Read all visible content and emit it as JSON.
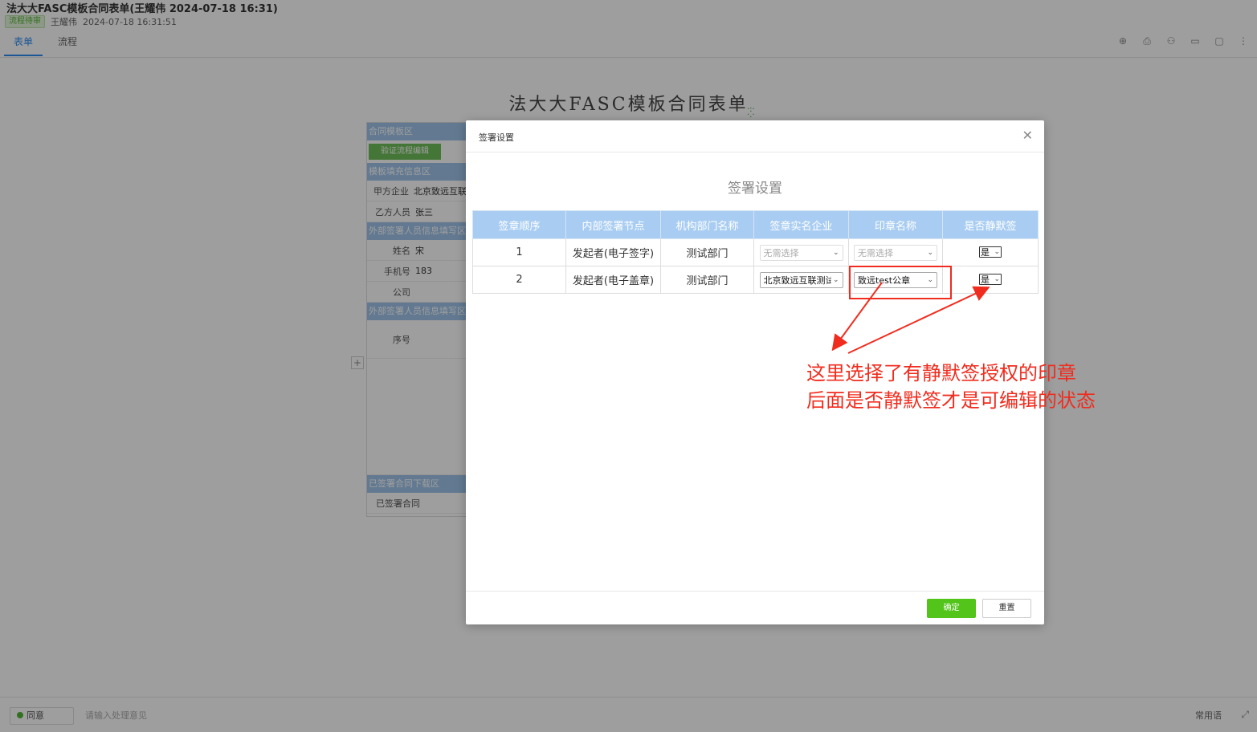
{
  "header": {
    "title": "法大大FASC模板合同表单(王耀伟 2024-07-18 16:31)",
    "status": "流程待审",
    "author": "王耀伟",
    "timestamp": "2024-07-18 16:31:51"
  },
  "tabs": [
    "表单",
    "流程"
  ],
  "form": {
    "title": "法大大FASC模板合同表单",
    "sections": {
      "contract_template": "合同模板区",
      "template_fill": "模板填充信息区",
      "external_signer": "外部签署人员信息填写区",
      "external_signer_2": "外部签署人员信息填写区",
      "signed_download": "已签署合同下载区"
    },
    "buttons": {
      "verify": "验证流程编辑"
    },
    "fields": [
      {
        "label": "甲方企业",
        "value": "北京致远互联"
      },
      {
        "label": "乙方人员",
        "value": "张三"
      },
      {
        "label": "姓名",
        "value": "宋"
      },
      {
        "label": "手机号",
        "value": "183"
      },
      {
        "label": "公司",
        "value": ""
      }
    ],
    "seq_label": "序号",
    "signed_contract_label": "已签署合同"
  },
  "bottom_bar": {
    "agree": "同意",
    "opinion_placeholder": "请输入处理意见",
    "common_phrases": "常用语"
  },
  "modal": {
    "title": "签署设置",
    "heading": "签署设置",
    "columns": [
      "签章顺序",
      "内部签署节点",
      "机构部门名称",
      "签章实名企业",
      "印章名称",
      "是否静默签"
    ],
    "rows": [
      {
        "order": "1",
        "node": "发起者(电子签字)",
        "dept": "测试部门",
        "company": "无需选择",
        "seal": "无需选择",
        "silent": "是"
      },
      {
        "order": "2",
        "node": "发起者(电子盖章)",
        "dept": "测试部门",
        "company": "北京致远互联测试",
        "seal": "致远test公章",
        "silent": "是"
      }
    ],
    "annotation": {
      "line1": "这里选择了有静默签授权的印章",
      "line2": "后面是否静默签才是可编辑的状态"
    },
    "ok_label": "确定",
    "cancel_label": "重置"
  },
  "colors": {
    "accent_green": "#52c41a",
    "annotation_red": "#f02c1e",
    "table_header": "#a9cdf2"
  }
}
